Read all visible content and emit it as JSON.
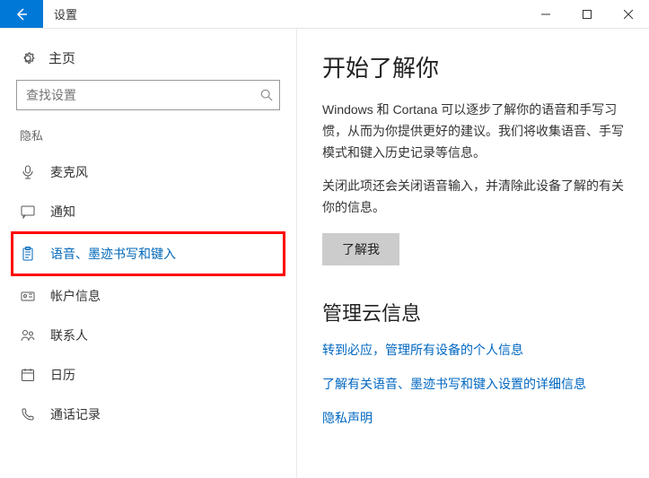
{
  "window": {
    "title": "设置"
  },
  "sidebar": {
    "home": "主页",
    "search_placeholder": "查找设置",
    "section": "隐私",
    "items": [
      {
        "label": "麦克风"
      },
      {
        "label": "通知"
      },
      {
        "label": "语音、墨迹书写和键入"
      },
      {
        "label": "帐户信息"
      },
      {
        "label": "联系人"
      },
      {
        "label": "日历"
      },
      {
        "label": "通话记录"
      }
    ]
  },
  "main": {
    "heading1": "开始了解你",
    "para1": "Windows 和 Cortana 可以逐步了解你的语音和手写习惯，从而为你提供更好的建议。我们将收集语音、手写模式和键入历史记录等信息。",
    "para2": "关闭此项还会关闭语音输入，并清除此设备了解的有关你的信息。",
    "button": "了解我",
    "heading2": "管理云信息",
    "link1": "转到必应，管理所有设备的个人信息",
    "link2": "了解有关语音、墨迹书写和键入设置的详细信息",
    "link3": "隐私声明"
  }
}
